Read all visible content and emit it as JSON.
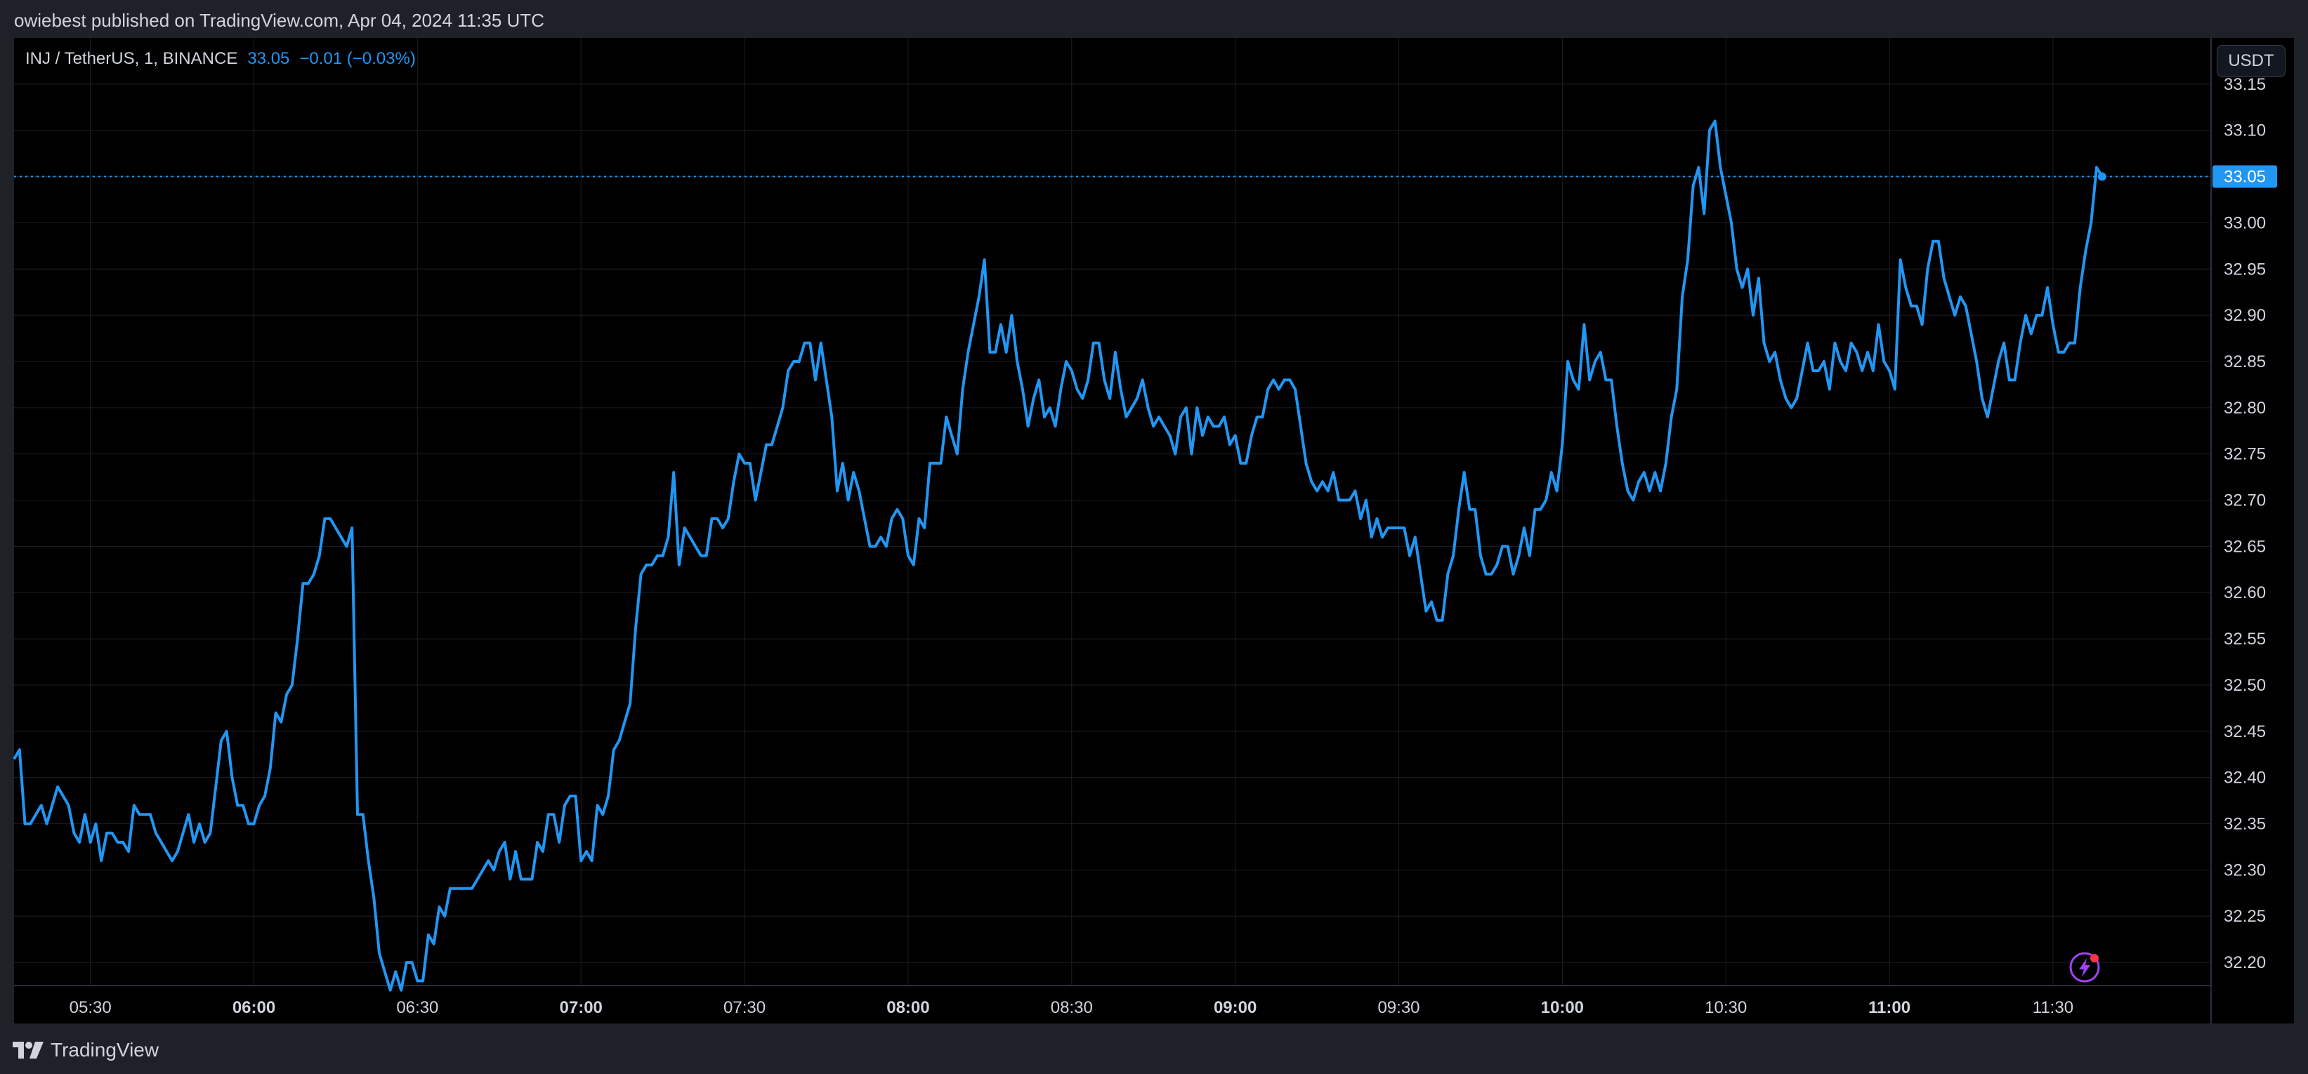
{
  "header": {
    "publish_info": "owiebest published on TradingView.com, Apr 04, 2024 11:35 UTC"
  },
  "legend": {
    "symbol": "INJ / TetherUS, 1, BINANCE",
    "price": "33.05",
    "change": "−0.01 (−0.03%)"
  },
  "currency_button": {
    "label": "USDT"
  },
  "footer": {
    "brand": "TradingView"
  },
  "colors": {
    "background": "#000000",
    "frame": "#1f2129",
    "line": "#2196f3",
    "grid": "#1c1f26",
    "text": "#d1d4dc"
  },
  "icons": [
    "tradingview-logo-icon",
    "lightning-icon"
  ],
  "chart_data": {
    "type": "line",
    "title": "",
    "xlabel": "",
    "ylabel": "",
    "last_price": "33.05",
    "ylim": [
      32.175,
      33.2
    ],
    "y_ticks": [
      "32.20",
      "32.25",
      "32.30",
      "32.35",
      "32.40",
      "32.45",
      "32.50",
      "32.55",
      "32.60",
      "32.65",
      "32.70",
      "32.75",
      "32.80",
      "32.85",
      "32.90",
      "32.95",
      "33.00",
      "33.05",
      "33.10",
      "33.15"
    ],
    "x_ticks": [
      {
        "label": "05:30",
        "minute": 330,
        "bold": false
      },
      {
        "label": "06:00",
        "minute": 360,
        "bold": true
      },
      {
        "label": "06:30",
        "minute": 390,
        "bold": false
      },
      {
        "label": "07:00",
        "minute": 420,
        "bold": true
      },
      {
        "label": "07:30",
        "minute": 450,
        "bold": false
      },
      {
        "label": "08:00",
        "minute": 480,
        "bold": true
      },
      {
        "label": "08:30",
        "minute": 510,
        "bold": false
      },
      {
        "label": "09:00",
        "minute": 540,
        "bold": true
      },
      {
        "label": "09:30",
        "minute": 570,
        "bold": false
      },
      {
        "label": "10:00",
        "minute": 600,
        "bold": true
      },
      {
        "label": "10:30",
        "minute": 630,
        "bold": false
      },
      {
        "label": "11:00",
        "minute": 660,
        "bold": true
      },
      {
        "label": "11:30",
        "minute": 690,
        "bold": false
      }
    ],
    "xlim_minutes": [
      316,
      719
    ],
    "series": [
      {
        "x_start_minute": 316,
        "values": [
          32.42,
          32.43,
          32.35,
          32.35,
          32.36,
          32.37,
          32.35,
          32.37,
          32.39,
          32.38,
          32.37,
          32.34,
          32.33,
          32.36,
          32.33,
          32.35,
          32.31,
          32.34,
          32.34,
          32.33,
          32.33,
          32.32,
          32.37,
          32.36,
          32.36,
          32.36,
          32.34,
          32.33,
          32.32,
          32.31,
          32.32,
          32.34,
          32.36,
          32.33,
          32.35,
          32.33,
          32.34,
          32.39,
          32.44,
          32.45,
          32.4,
          32.37,
          32.37,
          32.35,
          32.35,
          32.37,
          32.38,
          32.41,
          32.47,
          32.46,
          32.49,
          32.5,
          32.55,
          32.61,
          32.61,
          32.62,
          32.64,
          32.68,
          32.68,
          32.67,
          32.66,
          32.65,
          32.67,
          32.36,
          32.36,
          32.31,
          32.27,
          32.21,
          32.19,
          32.17,
          32.19,
          32.17,
          32.2,
          32.2,
          32.18,
          32.18,
          32.23,
          32.22,
          32.26,
          32.25,
          32.28,
          32.28,
          32.28,
          32.28,
          32.28,
          32.29,
          32.3,
          32.31,
          32.3,
          32.32,
          32.33,
          32.29,
          32.32,
          32.29,
          32.29,
          32.29,
          32.33,
          32.32,
          32.36,
          32.36,
          32.33,
          32.37,
          32.38,
          32.38,
          32.31,
          32.32,
          32.31,
          32.37,
          32.36,
          32.38,
          32.43,
          32.44,
          32.46,
          32.48,
          32.56,
          32.62,
          32.63,
          32.63,
          32.64,
          32.64,
          32.66,
          32.73,
          32.63,
          32.67,
          32.66,
          32.65,
          32.64,
          32.64,
          32.68,
          32.68,
          32.67,
          32.68,
          32.72,
          32.75,
          32.74,
          32.74,
          32.7,
          32.73,
          32.76,
          32.76,
          32.78,
          32.8,
          32.84,
          32.85,
          32.85,
          32.87,
          32.87,
          32.83,
          32.87,
          32.83,
          32.79,
          32.71,
          32.74,
          32.7,
          32.73,
          32.71,
          32.68,
          32.65,
          32.65,
          32.66,
          32.65,
          32.68,
          32.69,
          32.68,
          32.64,
          32.63,
          32.68,
          32.67,
          32.74,
          32.74,
          32.74,
          32.79,
          32.77,
          32.75,
          32.82,
          32.86,
          32.89,
          32.92,
          32.96,
          32.86,
          32.86,
          32.89,
          32.86,
          32.9,
          32.85,
          32.82,
          32.78,
          32.81,
          32.83,
          32.79,
          32.8,
          32.78,
          32.82,
          32.85,
          32.84,
          32.82,
          32.81,
          32.83,
          32.87,
          32.87,
          32.83,
          32.81,
          32.86,
          32.82,
          32.79,
          32.8,
          32.81,
          32.83,
          32.8,
          32.78,
          32.79,
          32.78,
          32.77,
          32.75,
          32.79,
          32.8,
          32.75,
          32.8,
          32.77,
          32.79,
          32.78,
          32.78,
          32.79,
          32.76,
          32.77,
          32.74,
          32.74,
          32.77,
          32.79,
          32.79,
          32.82,
          32.83,
          32.82,
          32.83,
          32.83,
          32.82,
          32.78,
          32.74,
          32.72,
          32.71,
          32.72,
          32.71,
          32.73,
          32.7,
          32.7,
          32.7,
          32.71,
          32.68,
          32.7,
          32.66,
          32.68,
          32.66,
          32.67,
          32.67,
          32.67,
          32.67,
          32.64,
          32.66,
          32.62,
          32.58,
          32.59,
          32.57,
          32.57,
          32.62,
          32.64,
          32.69,
          32.73,
          32.69,
          32.69,
          32.64,
          32.62,
          32.62,
          32.63,
          32.65,
          32.65,
          32.62,
          32.64,
          32.67,
          32.64,
          32.69,
          32.69,
          32.7,
          32.73,
          32.71,
          32.76,
          32.85,
          32.83,
          32.82,
          32.89,
          32.83,
          32.85,
          32.86,
          32.83,
          32.83,
          32.78,
          32.74,
          32.71,
          32.7,
          32.72,
          32.73,
          32.71,
          32.73,
          32.71,
          32.74,
          32.79,
          32.82,
          32.92,
          32.96,
          33.04,
          33.06,
          33.01,
          33.1,
          33.11,
          33.06,
          33.03,
          33.0,
          32.95,
          32.93,
          32.95,
          32.9,
          32.94,
          32.87,
          32.85,
          32.86,
          32.83,
          32.81,
          32.8,
          32.81,
          32.84,
          32.87,
          32.84,
          32.84,
          32.85,
          32.82,
          32.87,
          32.85,
          32.84,
          32.87,
          32.86,
          32.84,
          32.86,
          32.84,
          32.89,
          32.85,
          32.84,
          32.82,
          32.96,
          32.93,
          32.91,
          32.91,
          32.89,
          32.95,
          32.98,
          32.98,
          32.94,
          32.92,
          32.9,
          32.92,
          32.91,
          32.88,
          32.85,
          32.81,
          32.79,
          32.82,
          32.85,
          32.87,
          32.83,
          32.83,
          32.87,
          32.9,
          32.88,
          32.9,
          32.9,
          32.93,
          32.89,
          32.86,
          32.86,
          32.87,
          32.87,
          32.93,
          32.97,
          33.0,
          33.06,
          33.05
        ]
      }
    ]
  }
}
